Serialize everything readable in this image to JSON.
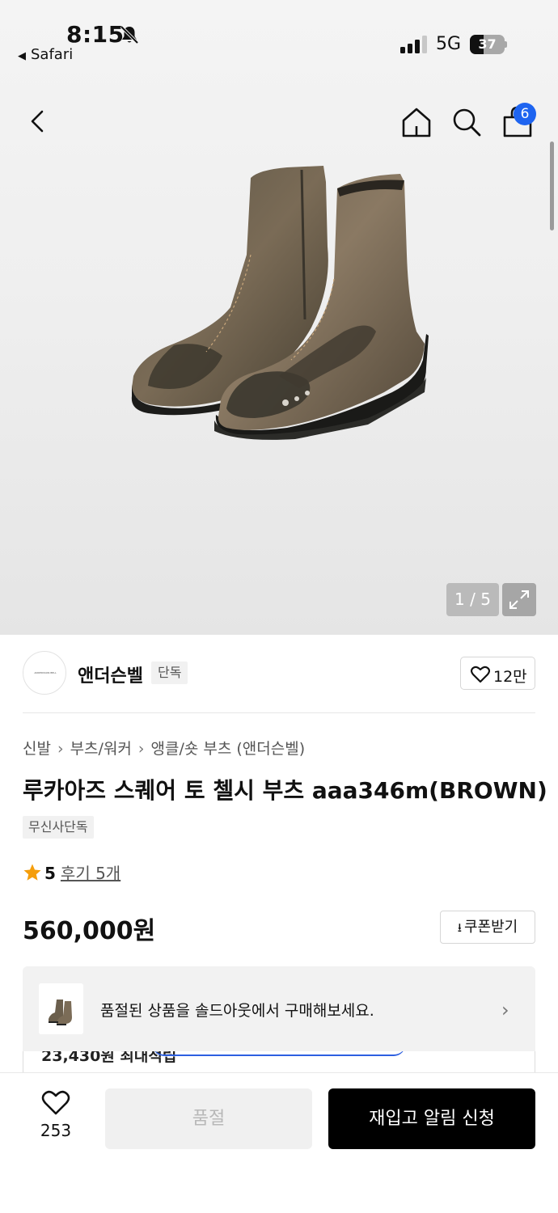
{
  "status_bar": {
    "time": "8:15",
    "back_app": "Safari",
    "network": "5G",
    "battery_level": "37"
  },
  "nav": {
    "cart_count": "6"
  },
  "gallery": {
    "counter": "1 / 5"
  },
  "brand": {
    "logo_text": "ANDERSSON BELL",
    "name": "앤더슨벨",
    "tag": "단독",
    "likes": "12만"
  },
  "product": {
    "breadcrumb": [
      "신발",
      "부츠/워커",
      "앵클/숏 부츠 (앤더슨벨)"
    ],
    "title": "루카아즈 스퀘어 토 첼시 부츠 aaa346m(BROWN)",
    "exclusive_badge": "무신사단독",
    "rating": "5",
    "reviews": "후기 5개",
    "price": "560,000원",
    "coupon_label": "쿠폰받기"
  },
  "soldout_banner": {
    "text": "품절된 상품을 솔드아웃에서 구매해보세요.",
    "chevron": "›"
  },
  "peek": {
    "text": "23,430원 최대적립"
  },
  "bottom_bar": {
    "wish_count": "253",
    "soldout_label": "품절",
    "restock_label": "재입고 알림 신청"
  },
  "colors": {
    "accent_blue": "#1e64f0",
    "primary_button": "#000000",
    "star": "#f59e0b"
  },
  "icons": [
    "bell-slash-icon",
    "back-chevron-icon",
    "home-icon",
    "search-icon",
    "cart-icon",
    "expand-icon",
    "heart-icon",
    "star-icon",
    "download-icon",
    "chevron-right-icon"
  ]
}
